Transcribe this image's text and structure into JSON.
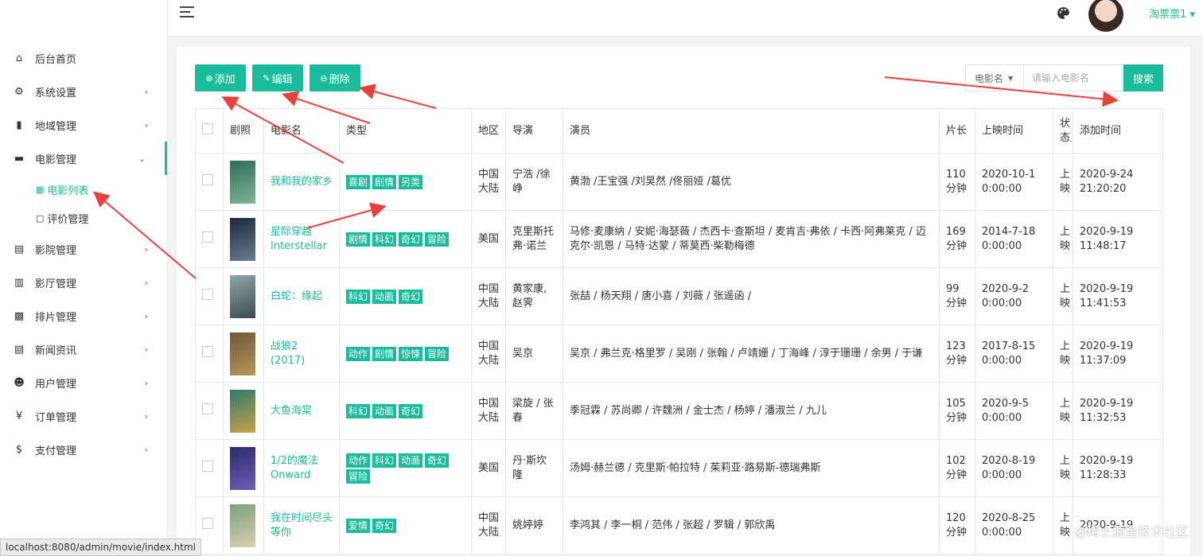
{
  "sidebar": {
    "items": [
      {
        "icon": "home-icon",
        "glyph": "⌂",
        "label": "后台首页",
        "chevron": ""
      },
      {
        "icon": "gear-icon",
        "glyph": "⚙",
        "label": "系统设置",
        "chevron": "›"
      },
      {
        "icon": "map-icon",
        "glyph": "▮",
        "label": "地域管理",
        "chevron": "›"
      },
      {
        "icon": "film-icon",
        "glyph": "▬",
        "label": "电影管理",
        "chevron": "⌄"
      }
    ],
    "sub_items": [
      {
        "icon": "grid-icon",
        "glyph": "▦",
        "label": "电影列表"
      },
      {
        "icon": "comment-icon",
        "glyph": "▢",
        "label": "评价管理"
      }
    ],
    "items_after": [
      {
        "icon": "cinema-icon",
        "glyph": "▤",
        "label": "影院管理",
        "chevron": "›"
      },
      {
        "icon": "building-icon",
        "glyph": "▥",
        "label": "影厅管理",
        "chevron": "›"
      },
      {
        "icon": "schedule-icon",
        "glyph": "▩",
        "label": "排片管理",
        "chevron": "›"
      },
      {
        "icon": "news-icon",
        "glyph": "▤",
        "label": "新闻资讯",
        "chevron": "›"
      },
      {
        "icon": "users-icon",
        "glyph": "☻",
        "label": "用户管理",
        "chevron": "›"
      },
      {
        "icon": "yen-icon",
        "glyph": "¥",
        "label": "订单管理",
        "chevron": "›"
      },
      {
        "icon": "dollar-icon",
        "glyph": "$",
        "label": "支付管理",
        "chevron": "›"
      }
    ]
  },
  "header": {
    "user_name": "淘票票1 ▾"
  },
  "toolbar": {
    "add_label": "添加",
    "edit_label": "编辑",
    "delete_label": "删除",
    "search_field": "电影名",
    "search_placeholder": "请输入电影名",
    "search_label": "搜索"
  },
  "table": {
    "headers": [
      "",
      "剧照",
      "电影名",
      "类型",
      "地区",
      "导演",
      "演员",
      "片长",
      "上映时间",
      "状态",
      "添加时间"
    ],
    "rows": [
      {
        "poster": [
          "#2f6b55",
          "#7fb59a"
        ],
        "title": "我和我的家乡",
        "tags": [
          "喜剧",
          "剧情",
          "另类"
        ],
        "region": "中国大陆",
        "director": "宁浩 /徐峥",
        "actors": "黄渤 /王宝强 /刘昊然 /佟丽娅 /葛优",
        "length": "110分钟",
        "release": "2020-10-1 0:00:00",
        "status": "上映",
        "added": "2020-9-24 21:20:20"
      },
      {
        "poster": [
          "#1c2a3a",
          "#6a7d8f"
        ],
        "title": "星际穿越 Interstellar",
        "tags": [
          "剧情",
          "科幻",
          "奇幻",
          "冒险"
        ],
        "region": "美国",
        "director": "克里斯托弗·诺兰",
        "actors": "马修·麦康纳 / 安妮·海瑟薇 / 杰西卡·查斯坦 / 麦肯吉·弗依 / 卡西·阿弗莱克 / 迈克尔·凯恩 / 马特·达蒙 / 蒂莫西·柴勒梅德",
        "length": "169分钟",
        "release": "2014-7-18 0:00:00",
        "status": "上映",
        "added": "2020-9-19 11:48:17"
      },
      {
        "poster": [
          "#8fa7a8",
          "#3c4a52"
        ],
        "title": "白蛇：缘起",
        "tags": [
          "科幻",
          "动画",
          "奇幻"
        ],
        "region": "中国大陆",
        "director": "黄家康, 赵霁",
        "actors": "张喆 / 杨天翔 / 唐小喜 / 刘薇 / 张遥函 /",
        "length": "99分钟",
        "release": "2020-9-2 0:00:00",
        "status": "上映",
        "added": "2020-9-19 11:41:53"
      },
      {
        "poster": [
          "#6b5a3a",
          "#b8945a"
        ],
        "title": "战狼2 (2017)",
        "tags": [
          "动作",
          "剧情",
          "惊悚",
          "冒险"
        ],
        "region": "中国大陆",
        "director": "吴京",
        "actors": "吴京 / 弗兰克·格里罗 / 吴刚 / 张翰 / 卢靖姗 / 丁海峰 / 淳于珊珊 / 余男 / 于谦",
        "length": "123分钟",
        "release": "2017-8-15 0:00:00",
        "status": "上映",
        "added": "2020-9-19 11:37:09"
      },
      {
        "poster": [
          "#2d7a6a",
          "#c9a24a"
        ],
        "title": "大鱼海棠",
        "tags": [
          "科幻",
          "动画",
          "奇幻"
        ],
        "region": "中国大陆",
        "director": "梁旋 / 张春",
        "actors": "季冠霖 / 苏尚卿 / 许魏洲 / 金士杰 / 杨婷 / 潘淑兰 / 九儿",
        "length": "105分钟",
        "release": "2020-9-5 0:00:00",
        "status": "上映",
        "added": "2020-9-19 11:32:53"
      },
      {
        "poster": [
          "#2a2a6a",
          "#6b5fb8"
        ],
        "title": "1/2的魔法 Onward",
        "tags": [
          "动作",
          "科幻",
          "动画",
          "奇幻",
          "冒险"
        ],
        "region": "美国",
        "director": "丹·斯坎隆",
        "actors": "汤姆·赫兰德 / 克里斯·帕拉特 / 茱莉亚·路易斯-德瑞弗斯",
        "length": "102分钟",
        "release": "2020-8-19 0:00:00",
        "status": "上映",
        "added": "2020-9-19 11:28:33"
      },
      {
        "poster": [
          "#7aa07a",
          "#d8d0b0"
        ],
        "title": "我在时间尽头等你",
        "tags": [
          "爱情",
          "奇幻"
        ],
        "region": "中国大陆",
        "director": "姚婷婷",
        "actors": "李鸿其 / 李一桐 / 范伟 / 张超 / 罗辑 / 郭欣禹",
        "length": "120分钟",
        "release": "2020-8-25 0:00:00",
        "status": "上映",
        "added": "2020-9-19"
      }
    ]
  },
  "status_bar": "localhost:8080/admin/movie/index.html",
  "watermark": "@稀土掘金技术社区",
  "colors": {
    "accent": "#1abc9c",
    "arrow": "#e8413a"
  }
}
